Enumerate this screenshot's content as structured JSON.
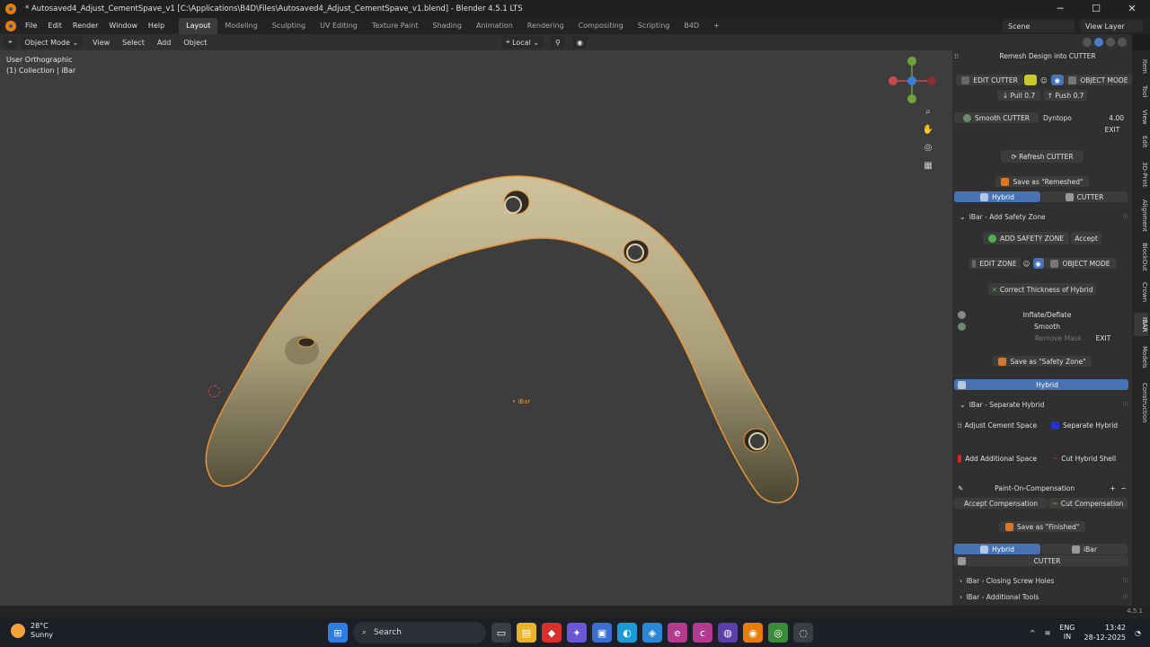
{
  "window": {
    "title": "* Autosaved4_Adjust_CementSpave_v1 [C:\\Applications\\B4D\\Files\\Autosaved4_Adjust_CementSpave_v1.blend] - Blender 4.5.1 LTS"
  },
  "menus": [
    "File",
    "Edit",
    "Render",
    "Window",
    "Help"
  ],
  "workspaces": [
    {
      "label": "Layout",
      "active": true
    },
    {
      "label": "Modeling"
    },
    {
      "label": "Sculpting"
    },
    {
      "label": "UV Editing"
    },
    {
      "label": "Texture Paint"
    },
    {
      "label": "Shading"
    },
    {
      "label": "Animation"
    },
    {
      "label": "Rendering"
    },
    {
      "label": "Compositing"
    },
    {
      "label": "Scripting"
    },
    {
      "label": "B4D"
    }
  ],
  "scene": {
    "name": "Scene",
    "view_layer": "View Layer"
  },
  "header": {
    "mode": "Object Mode",
    "menus": [
      "View",
      "Select",
      "Add",
      "Object"
    ],
    "transform_orientation": "Local"
  },
  "viewport": {
    "view_name": "User Orthographic",
    "collection": "(1) Collection | iBar",
    "object_label": "iBar"
  },
  "npanel": {
    "remesh_btn": "Remesh Design into CUTTER",
    "edit_cutter": "EDIT CUTTER",
    "object_mode": "OBJECT MODE",
    "pull": "Pull 0.7",
    "push": "Push 0.7",
    "smooth_cutter": "Smooth CUTTER",
    "dyntopo": "Dyntopo",
    "dyntopo_value": "4.00",
    "exit": "EXIT",
    "refresh_cutter": "Refresh CUTTER",
    "save_remeshed": "Save as \"Remeshed\"",
    "hybrid": "Hybrid",
    "cutter": "CUTTER",
    "sec_safety": "IBar - Add Safety Zone",
    "add_safety": "ADD SAFETY ZONE",
    "accept": "Accept",
    "edit_zone": "EDIT ZONE",
    "correct_thickness": "Correct Thickness of Hybrid",
    "inflate": "Inflate/Deflate",
    "smooth": "Smooth",
    "remove_mask": "Remove Mask",
    "save_safety": "Save as \"Safety Zone\"",
    "sec_separate": "IBar - Separate Hybrid",
    "adjust_cement": "Adjust Cement Space",
    "separate_hybrid": "Separate Hybrid",
    "add_additional": "Add Additional Space",
    "cut_hybrid_shell": "Cut Hybrid Shell",
    "paint_comp": "Paint-On-Compensation",
    "accept_comp": "Accept Compensation",
    "cut_comp": "Cut Compensation",
    "save_finished": "Save as \"Finished\"",
    "ibar": "iBar",
    "sec_closing": "IBar - Closing Screw Holes",
    "sec_additional": "IBar - Additional Tools"
  },
  "ntabs": [
    "Item",
    "Tool",
    "View",
    "Edit",
    "3D-Print",
    "Alignment",
    "BlockOut",
    "Crown",
    "IBAR",
    "Models",
    "Construction"
  ],
  "status": {
    "version": "4.5.1"
  },
  "taskbar": {
    "temperature": "28°C",
    "weather": "Sunny",
    "search": "Search",
    "lang1": "ENG",
    "lang2": "IN",
    "time": "13:42",
    "date": "28-12-2025"
  },
  "colors": {
    "accent_blue": "#4772b3",
    "object_outline": "#e8943a",
    "mesh": "#c9bd96"
  }
}
